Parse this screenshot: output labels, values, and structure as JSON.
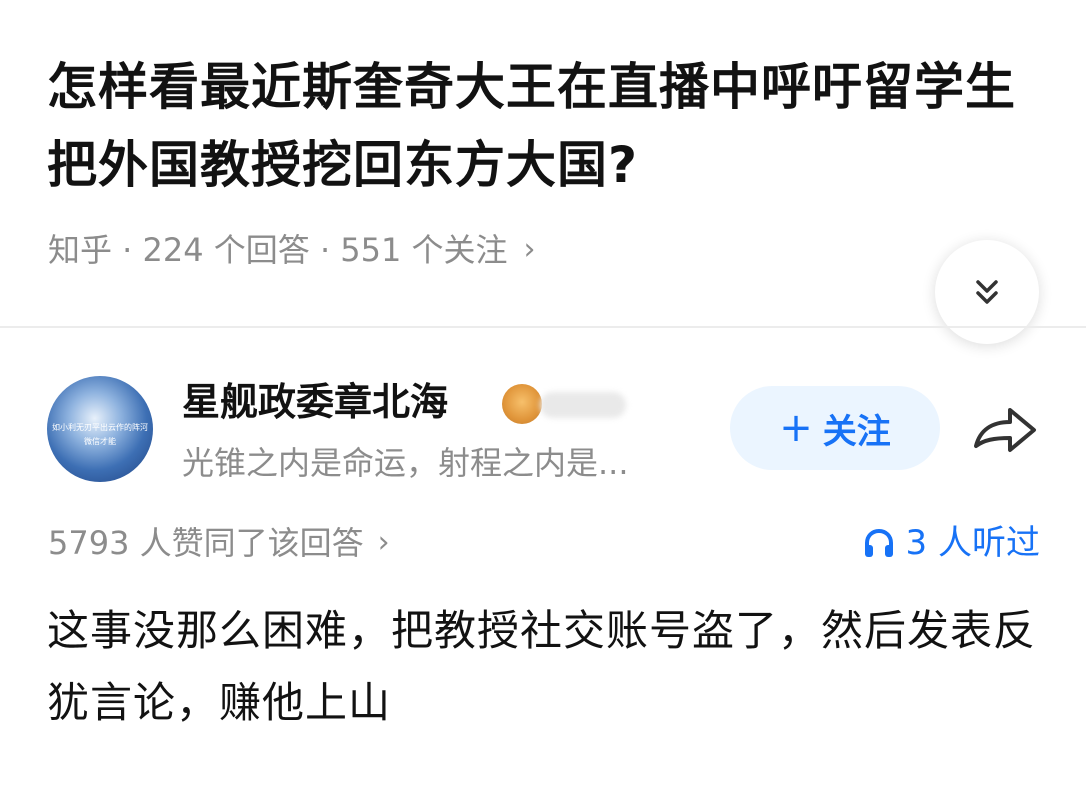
{
  "question": {
    "title": "怎样看最近斯奎奇大王在直播中呼吁留学生把外国教授挖回东方大国?",
    "meta": "知乎 · 224 个回答 · 551 个关注",
    "meta_chevron": "›"
  },
  "author": {
    "name": "星舰政委章北海",
    "bio": "光锥之内是命运，射程之内是...",
    "avatar_text": "如小利无刃平出云作的阵河",
    "avatar_text2": "微信才能"
  },
  "follow_button": {
    "plus": "+",
    "label": "关注"
  },
  "stats": {
    "votes": "5793 人赞同了该回答",
    "votes_chevron": "›",
    "listened": "3 人听过"
  },
  "answer": {
    "content": "这事没那么困难，把教授社交账号盗了，然后发表反犹言论，赚他上山"
  },
  "colors": {
    "accent": "#1772f6",
    "follow_bg": "#ebf5ff",
    "meta_text": "#8c8c8c",
    "title_text": "#121212"
  },
  "icons": {
    "collapse": "double-chevron-down-icon",
    "share": "share-arrow-icon",
    "listen": "headphone-icon",
    "badge": "badge-icon"
  }
}
